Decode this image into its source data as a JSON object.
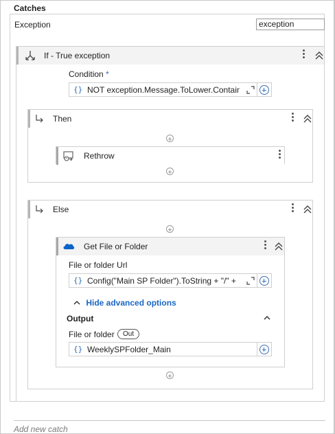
{
  "section_title": "Catches",
  "exception": {
    "label": "Exception",
    "value": "exception"
  },
  "if_activity": {
    "title": "If - True exception",
    "condition_label": "Condition",
    "condition_required_marker": "*",
    "condition_value": "NOT exception.Message.ToLower.Contains"
  },
  "then_branch": {
    "title": "Then",
    "rethrow": {
      "title": "Rethrow"
    }
  },
  "else_branch": {
    "title": "Else",
    "get_file": {
      "title": "Get File or Folder",
      "url_label": "File or folder Url",
      "url_value": "Config(\"Main SP Folder\").ToString + \"/\" +",
      "advanced_toggle": "Hide advanced options",
      "output_label": "Output",
      "file_or_folder_label": "File or folder",
      "out_badge": "Out",
      "file_or_folder_value": "WeeklySPFolder_Main"
    }
  },
  "add_new_catch": "Add new catch",
  "colors": {
    "accent": "#1a66c4",
    "brace": "#2f6db5",
    "onedrive": "#0a64c8"
  }
}
